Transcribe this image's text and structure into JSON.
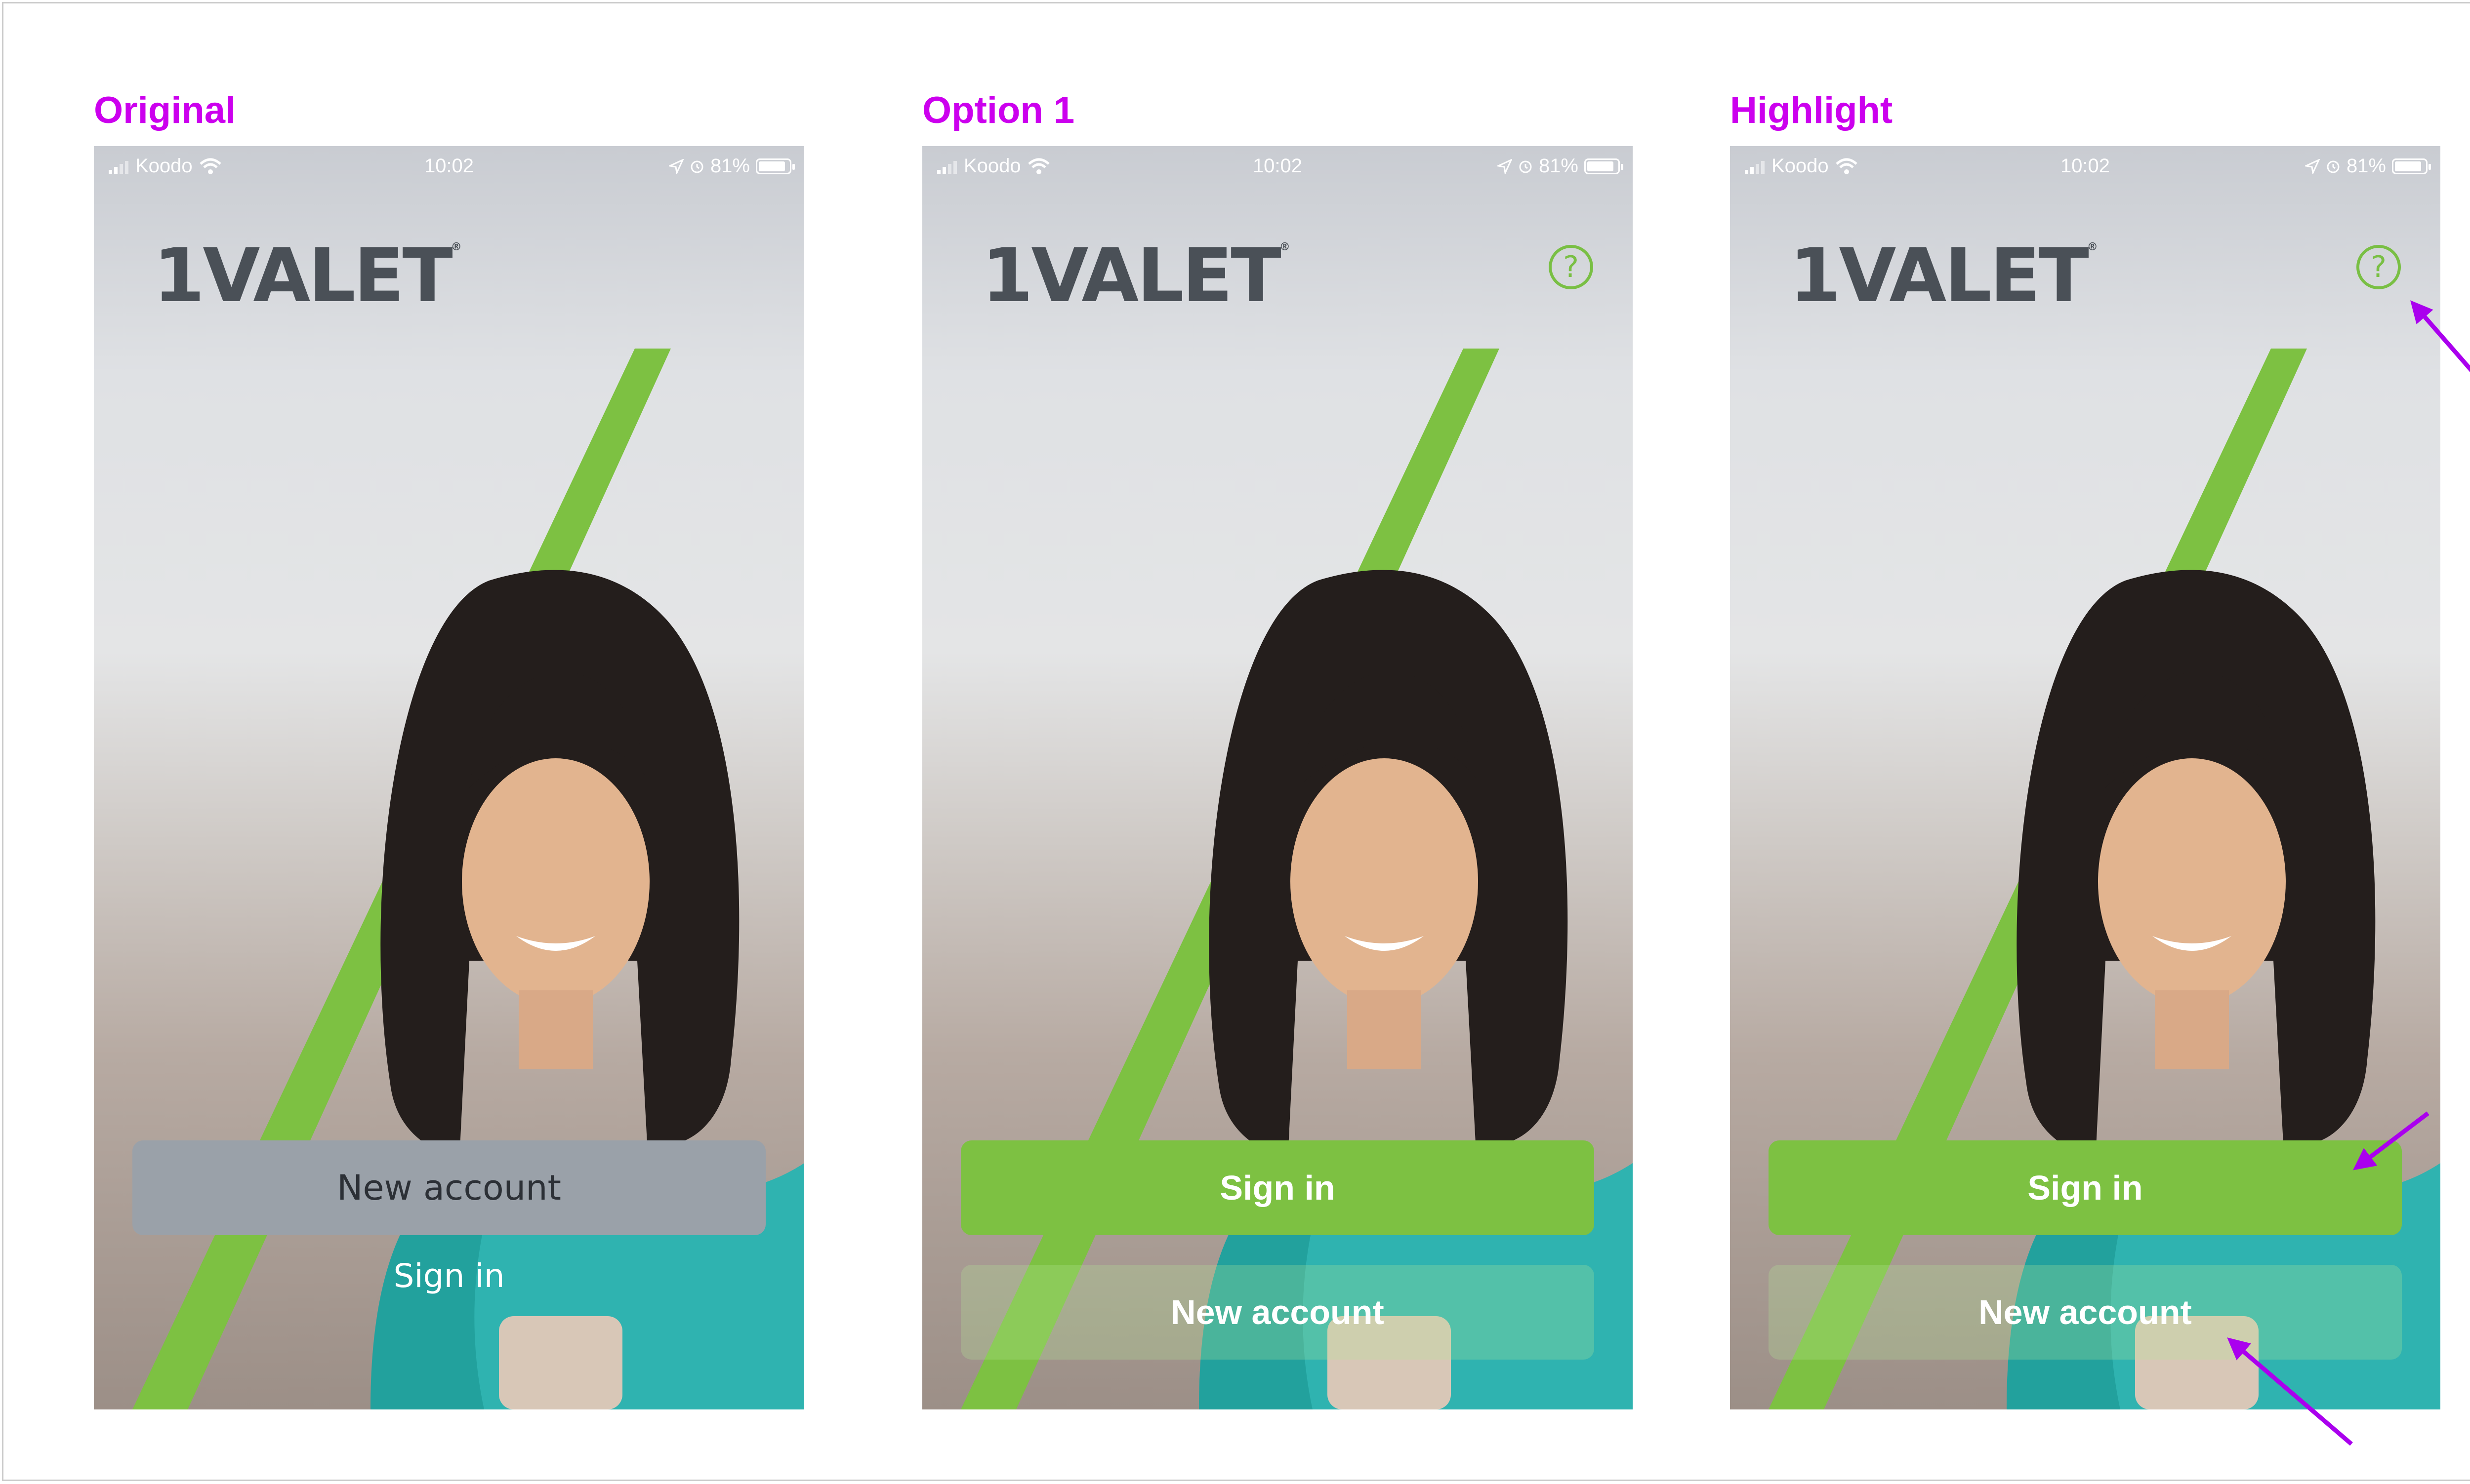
{
  "panels": [
    {
      "label": "Original",
      "status": {
        "carrier": "Koodo",
        "time": "10:02",
        "battery": "81%"
      },
      "logo": "1VALET",
      "logo_mark": "®",
      "primary_button": "New account",
      "secondary_link": "Sign in"
    },
    {
      "label": "Option 1",
      "status": {
        "carrier": "Koodo",
        "time": "10:02",
        "battery": "81%"
      },
      "logo": "1VALET",
      "logo_mark": "®",
      "help_icon": "?",
      "primary_button": "Sign in",
      "secondary_button": "New account"
    },
    {
      "label": "Highlight",
      "status": {
        "carrier": "Koodo",
        "time": "10:02",
        "battery": "81%"
      },
      "logo": "1VALET",
      "logo_mark": "®",
      "help_icon": "?",
      "primary_button": "Sign in",
      "secondary_button": "New account"
    }
  ],
  "colors": {
    "label": "#cc00ee",
    "brand_green": "#7dc142",
    "logo_gray": "#4a5057",
    "gray_button": "#9aa1a9",
    "annotation_arrow": "#aa00ee"
  },
  "icons": [
    "signal-bars-icon",
    "wifi-icon",
    "location-icon",
    "alarm-icon",
    "battery-icon",
    "help-icon",
    "annotation-arrow-icon"
  ],
  "battery_level": 0.81
}
